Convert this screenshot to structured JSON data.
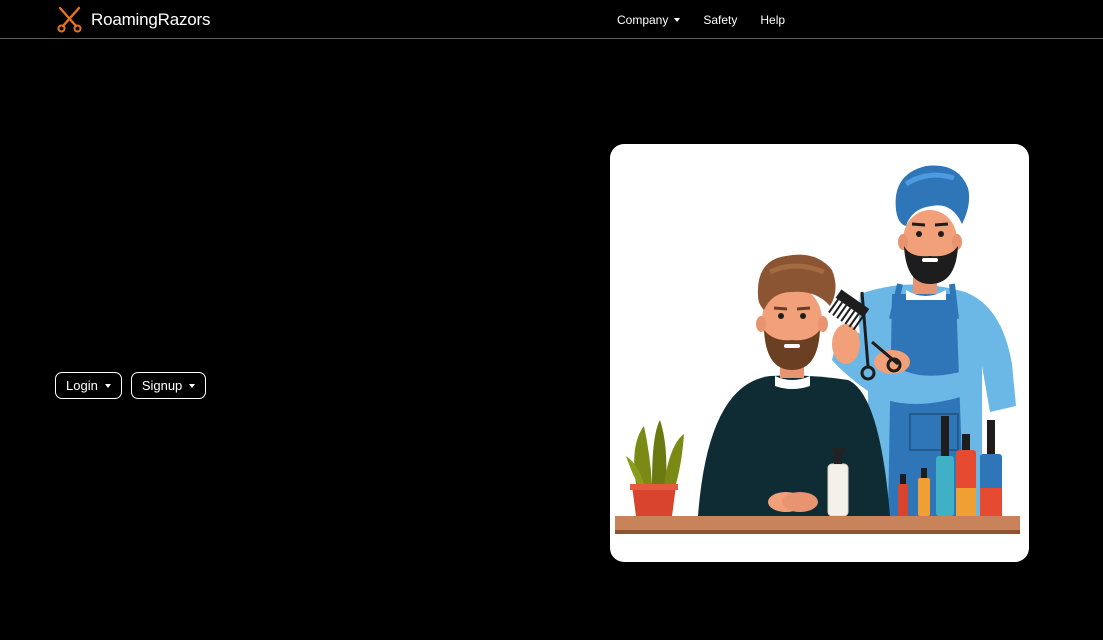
{
  "brand": {
    "name": "RoamingRazors",
    "icon": "scissors-icon",
    "accent_color": "#e8731a"
  },
  "nav": {
    "company_label": "Company",
    "safety_label": "Safety",
    "help_label": "Help"
  },
  "auth": {
    "login_label": "Login",
    "signup_label": "Signup"
  },
  "hero": {
    "illustration": "barber-cutting-hair-illustration"
  }
}
